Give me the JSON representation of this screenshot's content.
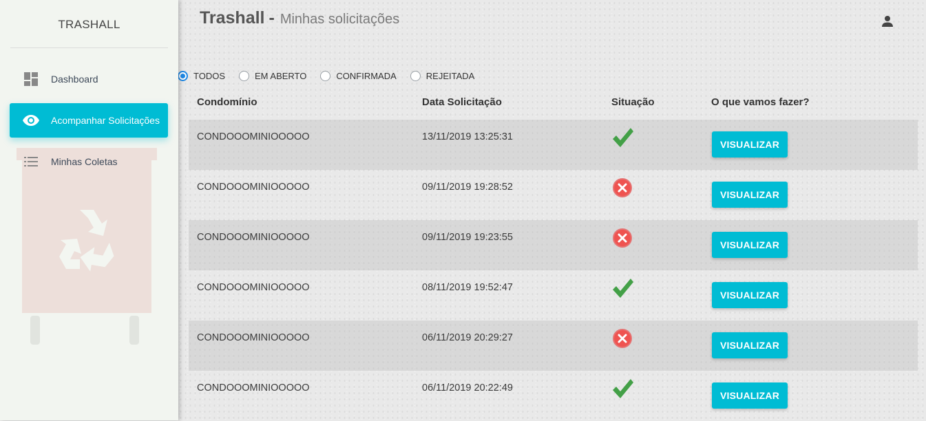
{
  "sidebar": {
    "brand": "TRASHALL",
    "items": [
      {
        "label": "Dashboard",
        "icon": "dashboard-icon",
        "active": false
      },
      {
        "label": "Acompanhar Solicitações",
        "icon": "eye-icon",
        "active": true
      },
      {
        "label": "Minhas Coletas",
        "icon": "list-icon",
        "active": false
      }
    ]
  },
  "header": {
    "title": "Trashall",
    "separator": "-",
    "subtitle": "Minhas solicitações",
    "user_icon": "person-icon"
  },
  "filters": [
    {
      "label": "TODOS",
      "checked": true
    },
    {
      "label": "EM ABERTO",
      "checked": false
    },
    {
      "label": "CONFIRMADA",
      "checked": false
    },
    {
      "label": "REJEITADA",
      "checked": false
    }
  ],
  "table": {
    "columns": [
      "Condomínio",
      "Data Solicitação",
      "Situação",
      "O que vamos fazer?"
    ],
    "rows": [
      {
        "condominio": "CONDOOOMINIOOOOO",
        "data": "13/11/2019 13:25:31",
        "status": "confirmed",
        "action": "VISUALIZAR"
      },
      {
        "condominio": "CONDOOOMINIOOOOO",
        "data": "09/11/2019 19:28:52",
        "status": "rejected",
        "action": "VISUALIZAR"
      },
      {
        "condominio": "CONDOOOMINIOOOOO",
        "data": "09/11/2019 19:23:55",
        "status": "rejected",
        "action": "VISUALIZAR"
      },
      {
        "condominio": "CONDOOOMINIOOOOO",
        "data": "08/11/2019 19:52:47",
        "status": "confirmed",
        "action": "VISUALIZAR"
      },
      {
        "condominio": "CONDOOOMINIOOOOO",
        "data": "06/11/2019 20:29:27",
        "status": "rejected",
        "action": "VISUALIZAR"
      },
      {
        "condominio": "CONDOOOMINIOOOOO",
        "data": "06/11/2019 20:22:49",
        "status": "confirmed",
        "action": "VISUALIZAR"
      }
    ]
  },
  "colors": {
    "accent": "#00bcd4",
    "radio_checked": "#1e88e5",
    "check_green": "#43a047",
    "reject_red": "#e53935"
  }
}
